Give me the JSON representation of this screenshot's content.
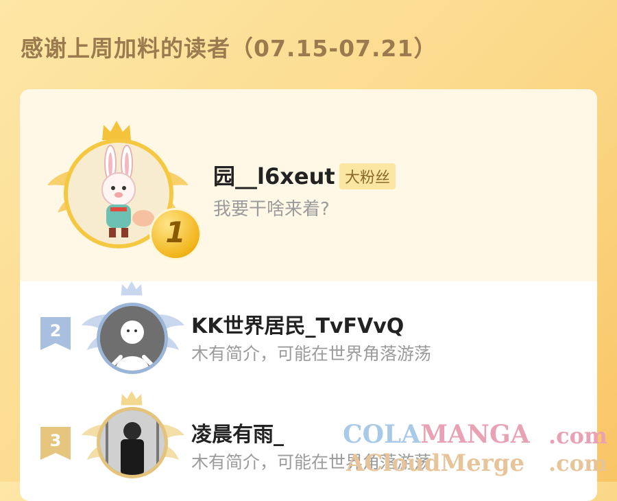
{
  "header": {
    "title": "感谢上周加料的读者（07.15-07.21）"
  },
  "readers": [
    {
      "rank": "1",
      "name": "园__l6xeut",
      "badge": "大粉丝",
      "bio": "我要干啥来着?"
    },
    {
      "rank": "2",
      "name": "KK世界居民_TvFVvQ",
      "bio": "木有简介，可能在世界角落游荡"
    },
    {
      "rank": "3",
      "name": "凌晨有雨_",
      "bio": "木有简介，可能在世界角落游荡"
    }
  ],
  "watermark": {
    "line1_a": "COLA",
    "line1_b": "MANGA",
    "line1_c": ".com",
    "line2_a": "ACloudMerge",
    "line2_b": ".com"
  },
  "colors": {
    "gold": "#f2b51c",
    "silver": "#9bb5d8",
    "bronze": "#e5c37a",
    "title": "#9a7a4e"
  }
}
